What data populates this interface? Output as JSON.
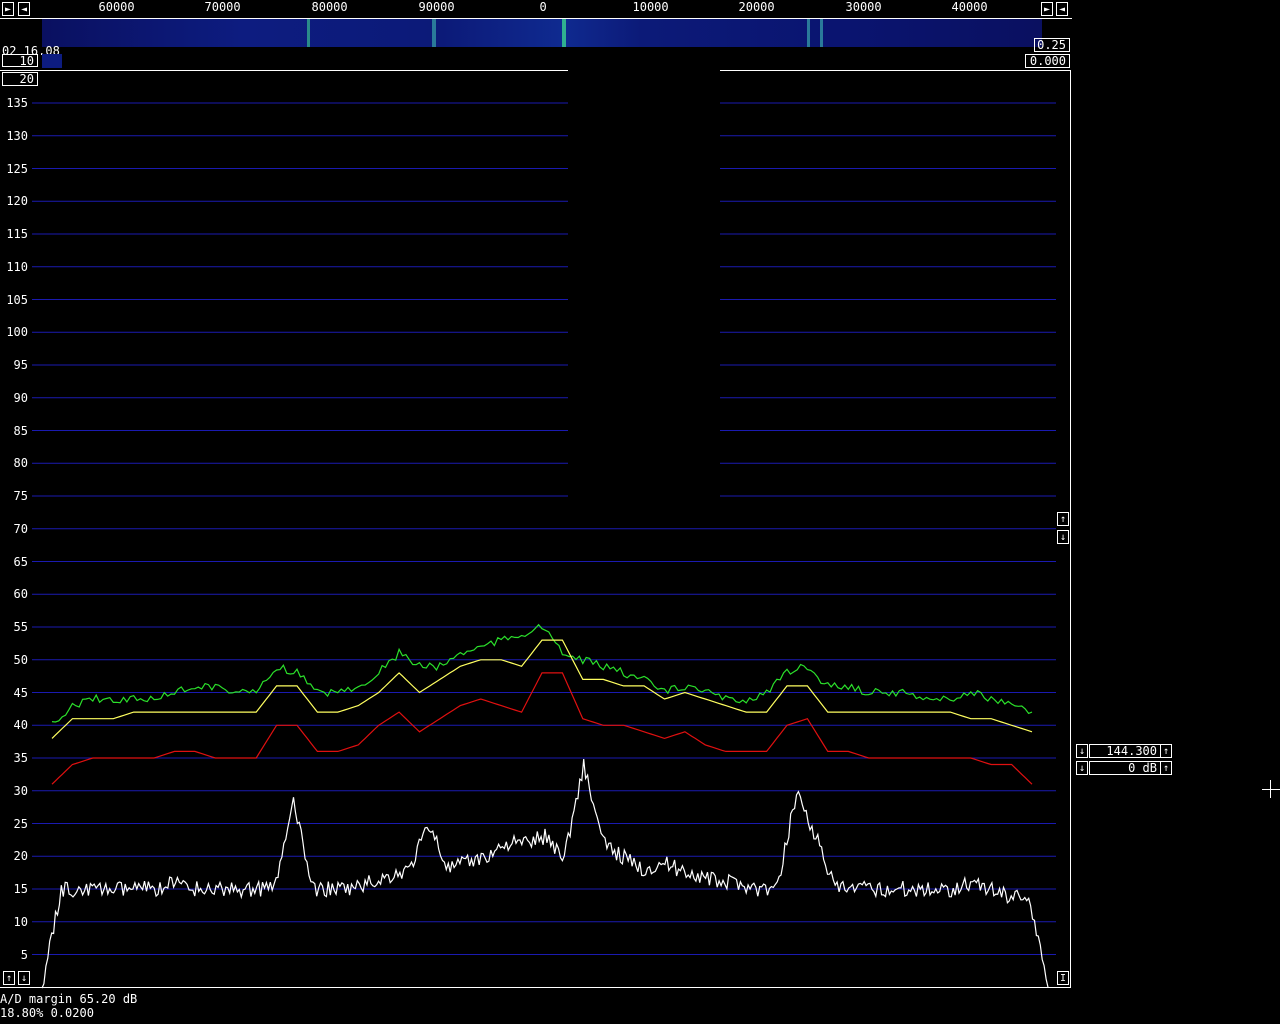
{
  "freq_axis": {
    "ticks": [
      "60000",
      "70000",
      "80000",
      "90000",
      "0",
      "10000",
      "20000",
      "30000",
      "40000"
    ]
  },
  "waterfall": {
    "time_label": "02 16.08",
    "gain_label": "10",
    "avg_label": "20",
    "right_top_value": "0.25",
    "right_bottom_value": "0.000"
  },
  "yaxis": {
    "ticks": [
      "135",
      "130",
      "125",
      "120",
      "115",
      "110",
      "105",
      "100",
      "95",
      "90",
      "85",
      "80",
      "75",
      "70",
      "65",
      "60",
      "55",
      "50",
      "45",
      "40",
      "35",
      "30",
      "25",
      "20",
      "15",
      "10",
      "5"
    ]
  },
  "right_panel": {
    "frequency_value": "144.300",
    "level_value": "0 dB"
  },
  "status": {
    "ad_margin": "A/D margin 65.20 dB",
    "stats": "18.80% 0.0200"
  },
  "icons": {
    "left_arrow": "◄",
    "right_arrow": "►",
    "up_arrow": "↑",
    "down_arrow": "↓",
    "i_glyph": "I"
  },
  "colors": {
    "grid": "#1a1ab0",
    "green_trace": "#2be02b",
    "yellow_trace": "#ffff60",
    "red_trace": "#e01010",
    "white_trace": "#ffffff",
    "waterfall_bg": "#0a1060"
  },
  "chart_data": {
    "type": "line",
    "ylim": [
      0,
      140
    ],
    "series": [
      {
        "color": "green",
        "values": [
          40,
          43,
          44,
          44,
          44,
          44,
          45,
          46,
          46,
          45,
          45,
          49,
          48,
          45,
          45,
          46,
          48,
          51,
          49,
          49,
          51,
          52,
          53,
          54,
          55,
          51,
          50,
          49,
          48,
          47,
          45,
          46,
          45,
          44,
          44,
          45,
          48,
          49,
          46,
          46,
          45,
          45,
          45,
          44,
          44,
          45,
          44,
          43,
          42
        ]
      },
      {
        "color": "yellow",
        "values": [
          38,
          41,
          41,
          41,
          42,
          42,
          42,
          42,
          42,
          42,
          42,
          46,
          46,
          42,
          42,
          43,
          45,
          48,
          45,
          47,
          49,
          50,
          50,
          49,
          53,
          53,
          47,
          47,
          46,
          46,
          44,
          45,
          44,
          43,
          42,
          42,
          46,
          46,
          42,
          42,
          42,
          42,
          42,
          42,
          42,
          41,
          41,
          40,
          39
        ]
      },
      {
        "color": "red",
        "values": [
          31,
          34,
          35,
          35,
          35,
          35,
          36,
          36,
          35,
          35,
          35,
          40,
          40,
          36,
          36,
          37,
          40,
          42,
          39,
          41,
          43,
          44,
          43,
          42,
          48,
          48,
          41,
          40,
          40,
          39,
          38,
          39,
          37,
          36,
          36,
          36,
          40,
          41,
          36,
          36,
          35,
          35,
          35,
          35,
          35,
          35,
          34,
          34,
          31
        ]
      },
      {
        "color": "white",
        "values": [
          0,
          15,
          15,
          15,
          15,
          15,
          15,
          16,
          15,
          15,
          15,
          15,
          15,
          28,
          15,
          15,
          15,
          16,
          17,
          18,
          25,
          18,
          19,
          20,
          22,
          22,
          23,
          20,
          34,
          22,
          20,
          18,
          19,
          18,
          17,
          16,
          16,
          15,
          15,
          30,
          23,
          15,
          15,
          15,
          15,
          15,
          15,
          15,
          16,
          15,
          14,
          14,
          0
        ]
      }
    ]
  }
}
